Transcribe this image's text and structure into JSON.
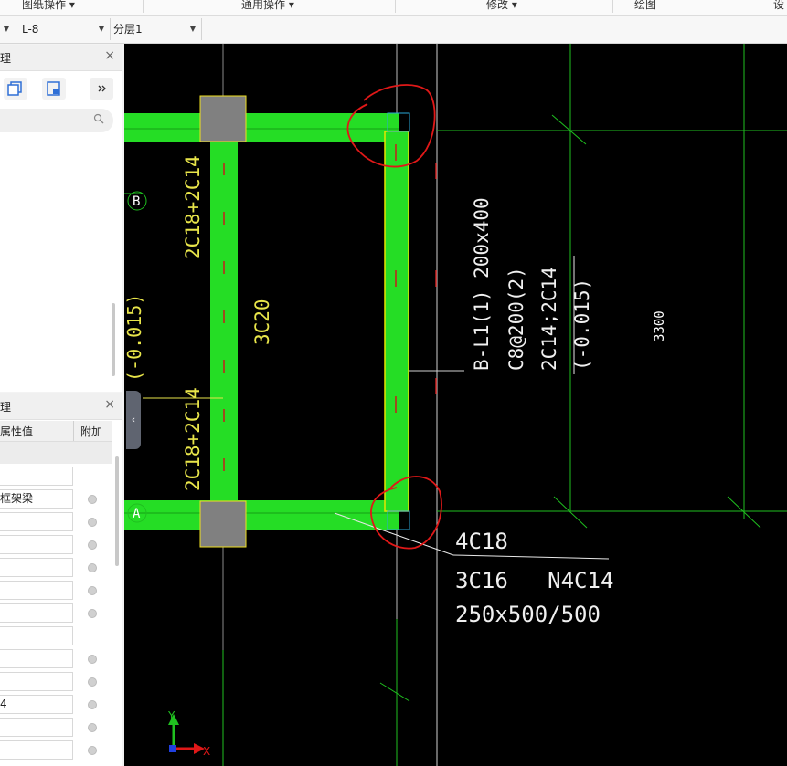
{
  "top_menu": {
    "items": [
      "图纸操作",
      "通用操作",
      "修改",
      "绘图",
      "设"
    ]
  },
  "selector_bar": {
    "component": "L-8",
    "layer": "分层1"
  },
  "panel1": {
    "title": "理",
    "close": "×"
  },
  "panel2": {
    "title": "理",
    "close": "×",
    "col_value": "属性值",
    "col_extra": "附加",
    "rows": [
      "",
      "框架梁",
      "",
      "",
      "",
      "",
      "",
      "",
      "",
      "",
      "4",
      "",
      ""
    ]
  },
  "canvas": {
    "axis_b": "B",
    "axis_a": "A",
    "col_rebar_top": "2C18+2C14",
    "col_rebar_mid": "3C20",
    "col_rebar_bottom": "2C18+2C14",
    "left_cut_text": "(-0.015)",
    "beam_line1": "B-L1(1) 200x400",
    "beam_line2": "C8@200(2)",
    "beam_line3": "2C14;2C14",
    "beam_line4": "(-0.015)",
    "dim_3300": "3300",
    "ann_top": "4C18",
    "ann_mid": "3C16   N4C14",
    "ann_bottom": "250x500/500",
    "ucs_y": "Y",
    "ucs_x": "X"
  }
}
